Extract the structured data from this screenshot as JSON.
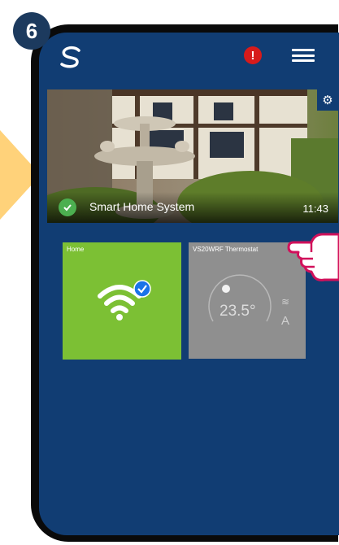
{
  "step_number": "6",
  "header": {
    "logo_icon": "salus-logo-icon",
    "alert_badge": "!",
    "menu_icon": "hamburger-menu-icon"
  },
  "system_card": {
    "name": "Smart Home System",
    "time": "11:43",
    "status_icon": "check-circle-icon",
    "settings_icon": "gear-icon"
  },
  "tiles": {
    "home": {
      "label": "Home",
      "icon": "wifi-icon",
      "status_icon": "check-circle-icon"
    },
    "thermostat": {
      "label": "VS20WRF Thermostat",
      "temperature": "23.5°",
      "heat_icon": "heat-waves-icon",
      "mode": "A"
    }
  },
  "colors": {
    "screen_background": "#113d73",
    "home_tile": "#7cc034",
    "thermostat_tile": "#8f8f8f",
    "alert": "#d71b1b",
    "pointer_accent": "#d1115b",
    "side_arrow": "#ffd27a"
  }
}
